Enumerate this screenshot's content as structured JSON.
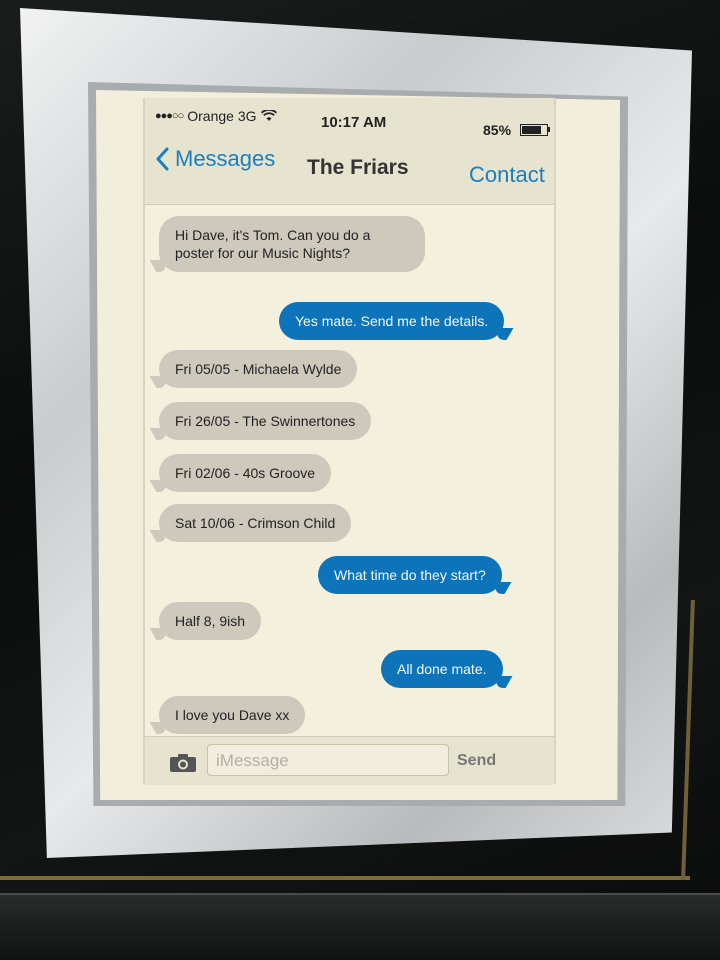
{
  "status_bar": {
    "signal_dots": "●●●○○",
    "carrier": "Orange 3G",
    "time": "10:17 AM",
    "battery": "85%",
    "battery_level": 0.85
  },
  "nav": {
    "back_label": "Messages",
    "title": "The Friars",
    "contact_label": "Contact"
  },
  "messages": [
    {
      "from": "them",
      "text": "Hi Dave, it's Tom. Can you do a\nposter for our Music Nights?"
    },
    {
      "from": "me",
      "text": "Yes mate. Send me the details."
    },
    {
      "from": "them",
      "text": "Fri 05/05 - Michaela Wylde"
    },
    {
      "from": "them",
      "text": "Fri 26/05 - The Swinnertones"
    },
    {
      "from": "them",
      "text": "Fri 02/06 - 40s Groove"
    },
    {
      "from": "them",
      "text": "Sat 10/06 - Crimson Child"
    },
    {
      "from": "me",
      "text": "What time do they start?"
    },
    {
      "from": "them",
      "text": "Half 8, 9ish"
    },
    {
      "from": "me",
      "text": "All done mate."
    },
    {
      "from": "them",
      "text": "I love you Dave xx"
    }
  ],
  "input": {
    "placeholder": "iMessage",
    "send_label": "Send"
  },
  "colors": {
    "outgoing_bubble": "#0d74ba",
    "incoming_bubble": "#cdc9bc",
    "accent": "#1a7fc0",
    "paper": "#f1eedc"
  }
}
